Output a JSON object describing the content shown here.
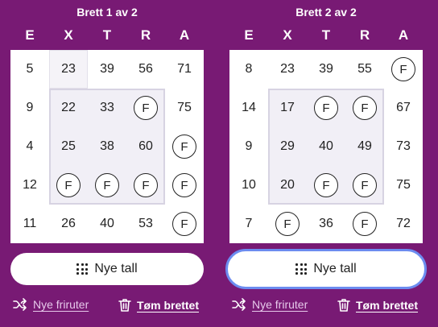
{
  "letters": [
    "E",
    "X",
    "T",
    "R",
    "A"
  ],
  "labels": {
    "new_numbers": "Nye tall",
    "new_free": "Nye friruter",
    "clear_board": "Tøm brettet"
  },
  "boards": [
    {
      "title": "Brett 1 av 2",
      "rows": [
        [
          "5",
          "23",
          "39",
          "56",
          "71"
        ],
        [
          "9",
          "22",
          "33",
          "F",
          "75"
        ],
        [
          "4",
          "25",
          "38",
          "60",
          "F"
        ],
        [
          "12",
          "F",
          "F",
          "F",
          "F"
        ],
        [
          "11",
          "26",
          "40",
          "53",
          "F"
        ]
      ]
    },
    {
      "title": "Brett 2 av 2",
      "rows": [
        [
          "8",
          "23",
          "39",
          "55",
          "F"
        ],
        [
          "14",
          "17",
          "F",
          "F",
          "67"
        ],
        [
          "9",
          "29",
          "40",
          "49",
          "73"
        ],
        [
          "10",
          "20",
          "F",
          "F",
          "75"
        ],
        [
          "7",
          "F",
          "36",
          "F",
          "72"
        ]
      ]
    }
  ],
  "colors": {
    "background": "#781a74",
    "focus_ring": "#6c8cf0"
  },
  "icons": {
    "new_numbers": "grid-dots-icon",
    "new_free": "shuffle-icon",
    "clear_board": "trash-icon"
  }
}
